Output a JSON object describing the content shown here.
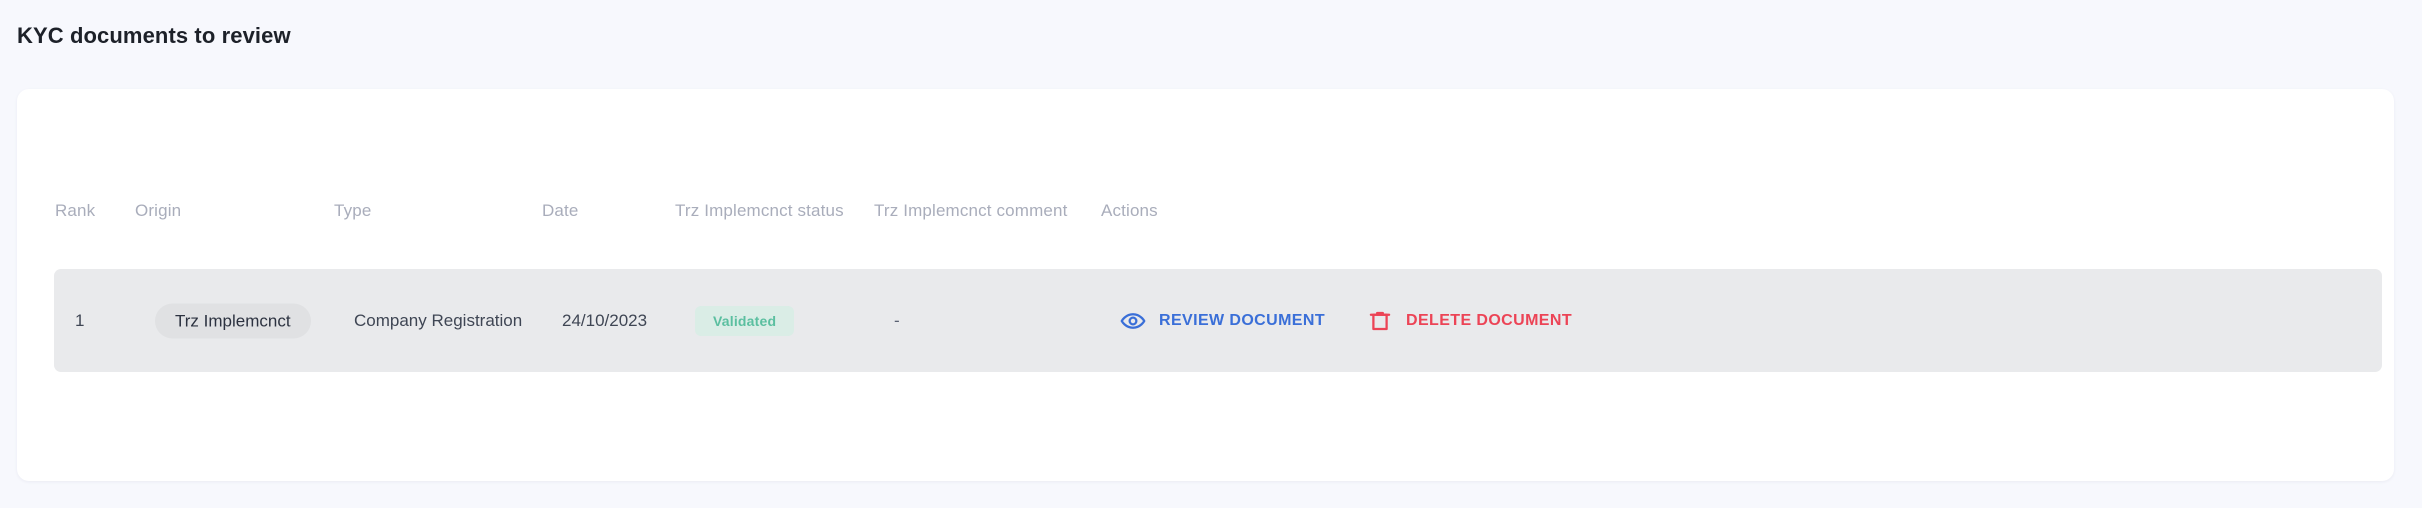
{
  "page": {
    "title": "KYC documents to review",
    "background_color": "#f7f8fd"
  },
  "table": {
    "columns": [
      {
        "key": "rank",
        "label": "Rank"
      },
      {
        "key": "origin",
        "label": "Origin"
      },
      {
        "key": "type",
        "label": "Type"
      },
      {
        "key": "date",
        "label": "Date"
      },
      {
        "key": "status",
        "label": "Trz Implemcnct status"
      },
      {
        "key": "comment",
        "label": "Trz Implemcnct comment"
      },
      {
        "key": "actions",
        "label": "Actions"
      }
    ],
    "rows": [
      {
        "rank": "1",
        "origin": "Trz Implemcnct",
        "type": "Company Registration",
        "date": "24/10/2023",
        "status": "Validated",
        "status_color": "#5bbfa0",
        "status_background": "#daede6",
        "comment": "-",
        "actions": {
          "review": {
            "label": "REVIEW DOCUMENT",
            "icon": "eye-icon",
            "color": "#3a6fd8"
          },
          "delete": {
            "label": "DELETE DOCUMENT",
            "icon": "trash-icon",
            "color": "#ec4456"
          }
        }
      }
    ]
  }
}
